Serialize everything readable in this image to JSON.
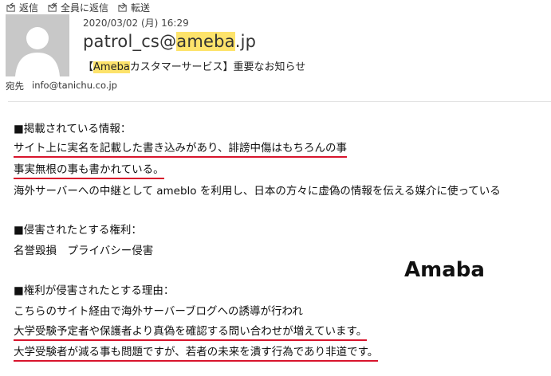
{
  "toolbar": {
    "reply": "返信",
    "reply_all": "全員に返信",
    "forward": "転送"
  },
  "message": {
    "datetime": "2020/03/02 (月) 16:29",
    "sender_pre": "patrol_cs@",
    "sender_hl": "ameba",
    "sender_post": ".jp",
    "subject_pre": "【",
    "subject_hl": "Ameba",
    "subject_post": "カスタマーサービス】重要なお知らせ",
    "to_label": "宛先",
    "to_value": "info@tanichu.co.jp"
  },
  "body_lines": {
    "l1": "■掲載されている情報：",
    "l2": "サイト上に実名を記載した書き込みがあり、誹謗中傷はもちろんの事",
    "l3": "事実無根の事も書かれている。",
    "l4": "海外サーバーへの中継として ameblo を利用し、日本の方々に虚偽の情報を伝える媒介に使っている",
    "l5": "■侵害されたとする権利：",
    "l6": "名誉毀損　プライバシー侵害",
    "l7": "■権利が侵害されたとする理由：",
    "l8": "こちらのサイト経由で海外サーバーブログへの誘導が行われ",
    "l9": "大学受験予定者や保護者より真偽を確認する問い合わせが増えています。",
    "l10": "大学受験者が減る事も問題ですが、若者の未来を潰す行為であり非道です。"
  },
  "annotation": {
    "stamp": "Amaba"
  },
  "colors": {
    "highlight": "#fde36b",
    "underline": "#d8142c"
  }
}
